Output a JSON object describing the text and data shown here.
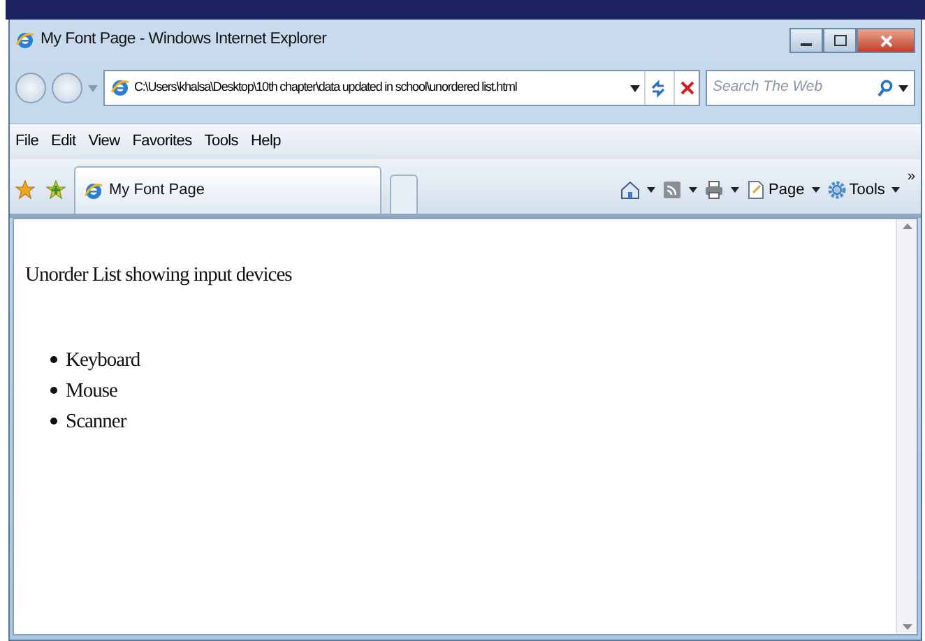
{
  "window": {
    "title": "My Font Page - Windows Internet Explorer"
  },
  "address_bar": {
    "value": "C:\\Users\\khalsa\\Desktop\\10th chapter\\data updated in school\\unordered list.html"
  },
  "search": {
    "placeholder": "Search The Web"
  },
  "menu": [
    "File",
    "Edit",
    "View",
    "Favorites",
    "Tools",
    "Help"
  ],
  "tabs": [
    {
      "label": "My Font Page",
      "selected": true
    }
  ],
  "command_bar": [
    {
      "kind": "home"
    },
    {
      "kind": "feeds"
    },
    {
      "kind": "print"
    },
    {
      "kind": "page",
      "label": "Page"
    },
    {
      "kind": "tools",
      "label": "Tools"
    }
  ],
  "overflow": "»",
  "page": {
    "heading": "Unorder List showing input devices",
    "items": [
      "Keyboard",
      "Mouse",
      "Scanner"
    ]
  }
}
